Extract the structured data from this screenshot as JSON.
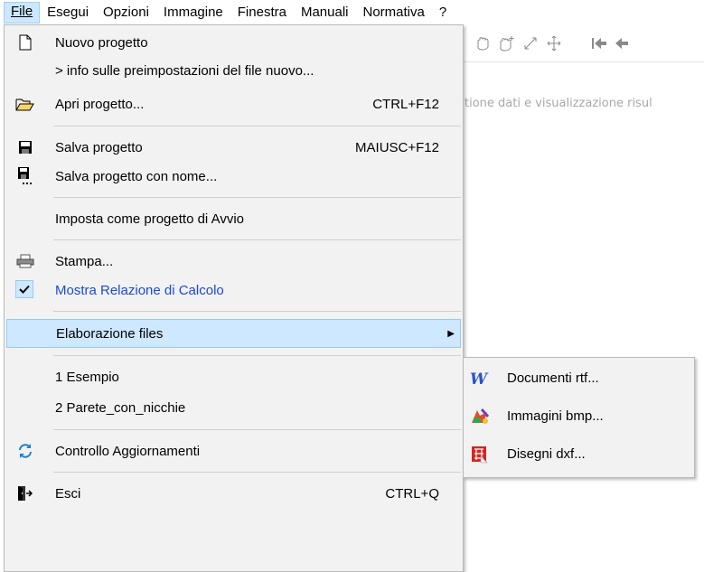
{
  "menubar": {
    "items": [
      {
        "label": "File",
        "active": true
      },
      {
        "label": "Esegui"
      },
      {
        "label": "Opzioni"
      },
      {
        "label": "Immagine"
      },
      {
        "label": "Finestra"
      },
      {
        "label": "Manuali"
      },
      {
        "label": "Normativa"
      },
      {
        "label": "?"
      }
    ]
  },
  "background": {
    "caption": "tione dati e visualizzazione risul",
    "toolbar_icons": [
      "zoom-hand-icon",
      "zoom-add-icon",
      "resize-diagonal-icon",
      "move-icon",
      "first-page-icon",
      "previous-icon"
    ]
  },
  "file_menu": {
    "items": [
      {
        "label": "Nuovo progetto",
        "icon": "new-document-icon",
        "shortcut": ""
      },
      {
        "label": ">   info sulle preimpostazioni del file nuovo...",
        "icon": "",
        "shortcut": ""
      },
      {
        "label": "Apri progetto...",
        "icon": "open-folder-icon",
        "shortcut": "CTRL+F12"
      },
      {
        "label": "Salva progetto",
        "icon": "floppy-disk-icon",
        "shortcut": "MAIUSC+F12"
      },
      {
        "label": "Salva progetto con nome...",
        "icon": "floppy-save-as-icon",
        "shortcut": ""
      },
      {
        "label": "Imposta come progetto di Avvio",
        "icon": "",
        "shortcut": ""
      },
      {
        "label": "Stampa...",
        "icon": "printer-icon",
        "shortcut": ""
      },
      {
        "label": "Mostra Relazione di Calcolo",
        "icon": "checkmark-icon",
        "shortcut": "",
        "checked": true
      },
      {
        "label": "Elaborazione files",
        "icon": "",
        "shortcut": "",
        "submenu": true,
        "highlighted": true
      },
      {
        "label": "1 Esempio",
        "icon": "",
        "shortcut": ""
      },
      {
        "label": "2 Parete_con_nicchie",
        "icon": "",
        "shortcut": ""
      },
      {
        "label": "Controllo Aggiornamenti",
        "icon": "refresh-icon",
        "shortcut": ""
      },
      {
        "label": "Esci",
        "icon": "exit-door-icon",
        "shortcut": "CTRL+Q"
      }
    ]
  },
  "submenu": {
    "items": [
      {
        "label": "Documenti rtf...",
        "icon": "word-document-icon"
      },
      {
        "label": "Immagini bmp...",
        "icon": "paint-palette-icon"
      },
      {
        "label": "Disegni dxf...",
        "icon": "cad-drawing-icon"
      }
    ]
  },
  "colors": {
    "menu_bg": "#f2f2f2",
    "highlight_bg": "#cde8ff",
    "highlight_border": "#99c9ef",
    "link_text": "#1a49d9"
  }
}
